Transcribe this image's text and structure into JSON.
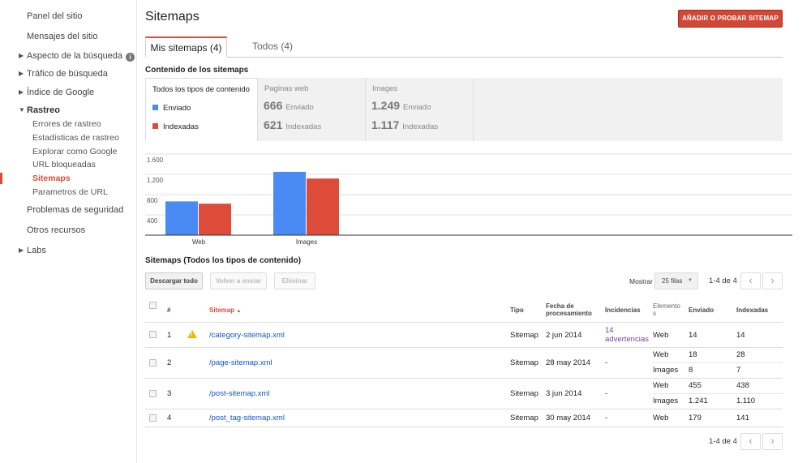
{
  "sidebar": {
    "panel": "Panel del sitio",
    "messages": "Mensajes del sitio",
    "search_appearance": "Aspecto de la búsqueda",
    "search_traffic": "Tráfico de búsqueda",
    "google_index": "Índice de Google",
    "crawl": "Rastreo",
    "crawl_items": [
      "Errores de rastreo",
      "Estadísticas de rastreo",
      "Explorar como Google",
      "URL bloqueadas",
      "Sitemaps",
      "Parametros de URL"
    ],
    "security": "Problemas de seguridad",
    "other": "Otros recursos",
    "labs": "Labs"
  },
  "header": {
    "title": "Sitemaps",
    "add_button": "AÑADIR O PROBAR SITEMAP"
  },
  "tabs": [
    {
      "label": "Mis sitemaps (4)"
    },
    {
      "label": "Todos (4)"
    }
  ],
  "content": {
    "heading": "Contenido de los sitemaps",
    "all_types": "Todos los tipos de contenido",
    "legend_sent": "Enviado",
    "legend_indexed": "Indexadas",
    "colors": {
      "sent": "#4a8af4",
      "indexed": "#dd4b39"
    },
    "web": {
      "title": "Paginas web",
      "sent": "666",
      "sent_label": "Enviado",
      "indexed": "621",
      "indexed_label": "Indexadas"
    },
    "images": {
      "title": "Images",
      "sent": "1.249",
      "sent_label": "Enviado",
      "indexed": "1.117",
      "indexed_label": "Indexadas"
    }
  },
  "chart_data": {
    "type": "bar",
    "categories": [
      "Web",
      "Images"
    ],
    "series": [
      {
        "name": "Enviado",
        "values": [
          666,
          1249
        ]
      },
      {
        "name": "Indexadas",
        "values": [
          621,
          1117
        ]
      }
    ],
    "ylim": [
      0,
      1600
    ],
    "yticks": [
      "1.600",
      "1.200",
      "800",
      "400"
    ],
    "ytick_values": [
      1600,
      1200,
      800,
      400
    ],
    "grid": true
  },
  "sitemaps": {
    "heading": "Sitemaps (Todos los tipos de contenido)",
    "download": "Descargar todo",
    "resend": "Volver a enviar",
    "delete": "Eliminar",
    "show": "Mostrar",
    "rows": "25 filas",
    "range": "1-4 de 4",
    "prev": "‹",
    "next": "›",
    "columns": {
      "num": "#",
      "sitemap": "Sitemap",
      "sort_arrow": "▲",
      "type": "Tipo",
      "date_1": "Fecha de",
      "date_2": "procesamiento",
      "issues": "Incidencias",
      "elements_1": "Elemento",
      "elements_2": "s",
      "sent": "Enviado",
      "indexed": "Indexadas"
    },
    "rows_data": [
      {
        "num": "1",
        "warn": true,
        "url": "/category-sitemap.xml",
        "type": "Sitemap",
        "date": "2 jun 2014",
        "issues_1": "14",
        "issues_2": "advertencias",
        "entries": [
          {
            "element": "Web",
            "sent": "14",
            "indexed": "14"
          }
        ]
      },
      {
        "num": "2",
        "warn": false,
        "url": "/page-sitemap.xml",
        "type": "Sitemap",
        "date": "28 may 2014",
        "issues": "-",
        "entries": [
          {
            "element": "Web",
            "sent": "18",
            "indexed": "28"
          },
          {
            "element": "Images",
            "sent": "8",
            "indexed": "7"
          }
        ]
      },
      {
        "num": "3",
        "warn": false,
        "url": "/post-sitemap.xml",
        "type": "Sitemap",
        "date": "3 jun 2014",
        "issues": "-",
        "entries": [
          {
            "element": "Web",
            "sent": "455",
            "indexed": "438"
          },
          {
            "element": "Images",
            "sent": "1.241",
            "indexed": "1.110"
          }
        ]
      },
      {
        "num": "4",
        "warn": false,
        "url": "/post_tag-sitemap.xml",
        "type": "Sitemap",
        "date": "30 may 2014",
        "issues": "-",
        "entries": [
          {
            "element": "Web",
            "sent": "179",
            "indexed": "141"
          }
        ]
      }
    ]
  }
}
